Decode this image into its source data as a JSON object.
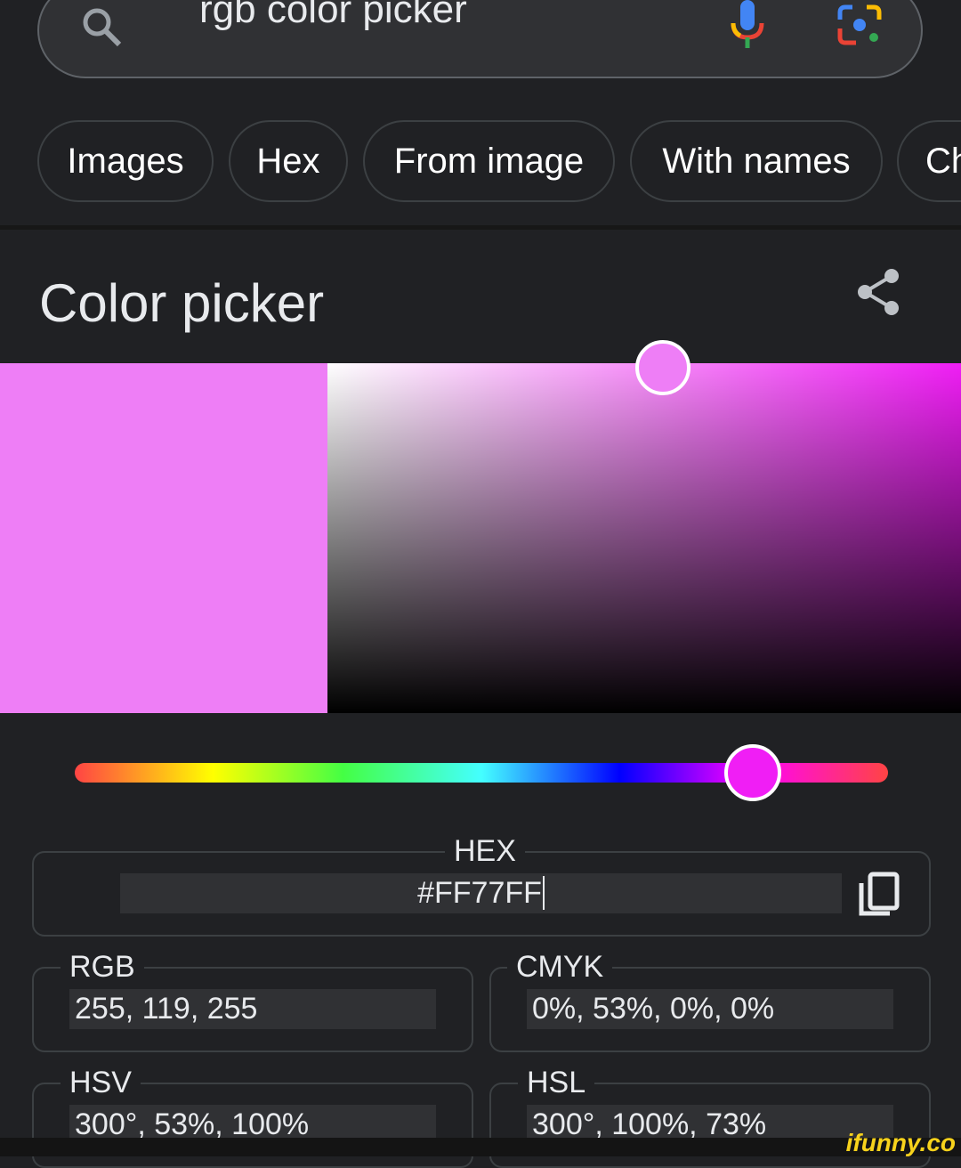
{
  "search": {
    "query": "rgb color picker",
    "search_icon": "search-icon",
    "mic_icon": "mic-icon",
    "lens_icon": "lens-icon"
  },
  "chips": [
    "Images",
    "Hex",
    "From image",
    "With names",
    "Ch"
  ],
  "widget": {
    "title": "Color picker",
    "share_icon": "share-icon",
    "color": "#FF77FF",
    "swatch_color": "#EE7EF6",
    "hue_color": "#F01EF5",
    "saturation": 0.53,
    "value": 1.0,
    "hue_deg": 300,
    "hex_label": "HEX",
    "hex_value": "#FF77FF",
    "copy_icon": "copy-icon",
    "rgb_label": "RGB",
    "rgb_value": "255, 119, 255",
    "cmyk_label": "CMYK",
    "cmyk_value": "0%, 53%, 0%, 0%",
    "hsv_label": "HSV",
    "hsv_value": "300°, 53%, 100%",
    "hsl_label": "HSL",
    "hsl_value": "300°, 100%, 73%"
  },
  "watermark": "ifunny.co"
}
